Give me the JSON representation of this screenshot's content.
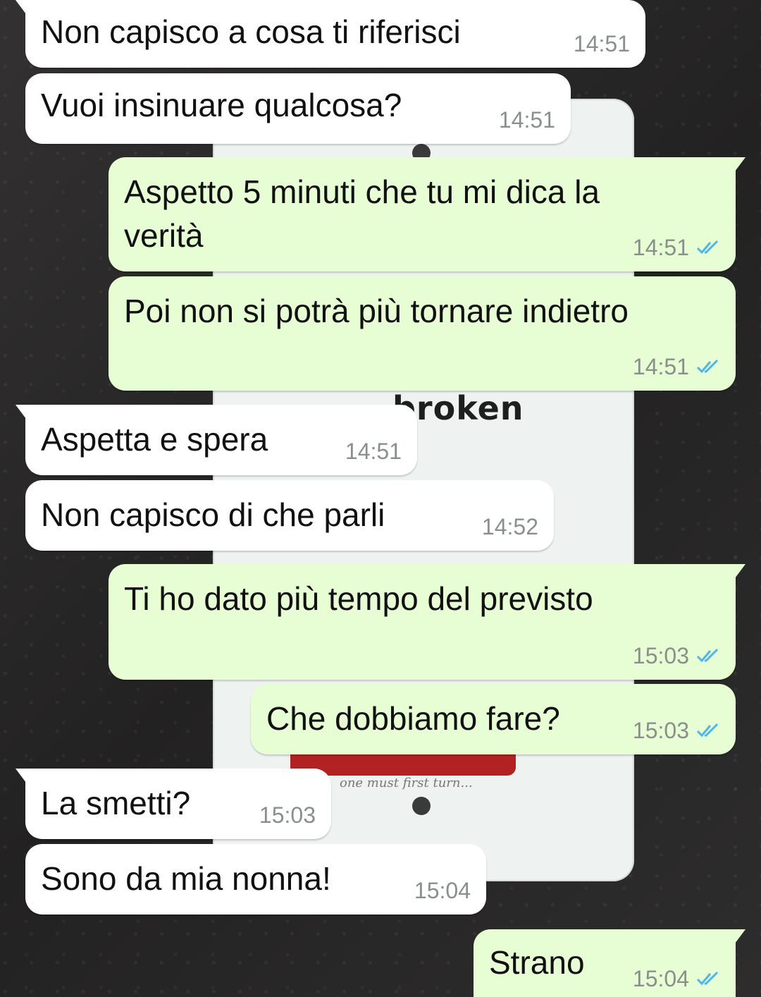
{
  "chat": {
    "messages": [
      {
        "dir": "in",
        "text": "Non capisco a cosa ti riferisci",
        "time": "14:51"
      },
      {
        "dir": "in",
        "text": "Vuoi insinuare qualcosa?",
        "time": "14:51"
      },
      {
        "dir": "out",
        "text": "Aspetto 5 minuti che tu mi dica la\nverità",
        "time": "14:51",
        "status": "read"
      },
      {
        "dir": "out",
        "text": "Poi non si potrà più tornare indietro",
        "time": "14:51",
        "status": "read"
      },
      {
        "dir": "in",
        "text": "Aspetta e spera",
        "time": "14:51"
      },
      {
        "dir": "in",
        "text": "Non capisco di che parli",
        "time": "14:52"
      },
      {
        "dir": "out",
        "text": "Ti ho dato più tempo del previsto",
        "time": "15:03",
        "status": "read"
      },
      {
        "dir": "out",
        "text": "Che dobbiamo fare?",
        "time": "15:03",
        "status": "read"
      },
      {
        "dir": "in",
        "text": "La smetti?",
        "time": "15:03"
      },
      {
        "dir": "in",
        "text": "Sono da mia nonna!",
        "time": "15:04"
      },
      {
        "dir": "out",
        "text": "Strano",
        "time": "15:04",
        "status": "read"
      }
    ]
  },
  "wallpaper": {
    "sign_text": "broken",
    "sign_scribble": "one must first turn..."
  },
  "colors": {
    "incoming_bubble": "#ffffff",
    "outgoing_bubble": "#e7fdd4",
    "read_tick": "#4fb6ec",
    "timestamp": "#8a8f8c"
  }
}
